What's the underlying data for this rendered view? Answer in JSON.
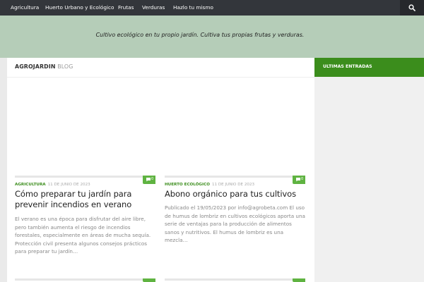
{
  "nav": {
    "items": [
      "Agricultura",
      "Huerto Urbano y Ecológico",
      "Frutas",
      "Verduras",
      "Hazlo tu mismo"
    ],
    "search_icon": "search-icon"
  },
  "header": {
    "tagline": "Cultivo ecológico en tu propio jardín. Cultiva tus propias frutas y verduras."
  },
  "main": {
    "title_strong": "Agrojardin",
    "title_light": "Blog",
    "posts": [
      {
        "category": "Agricultura",
        "date": "11 de junio de 2023",
        "comments": "0",
        "title": "Cómo preparar tu jardín para prevenir incendios en verano",
        "excerpt": "El verano es una época para disfrutar del aire libre, pero también aumenta el riesgo de incendios forestales, especialmente en áreas de mucha sequía. Protección civil presenta algunos consejos prácticos para preparar tu jardín…"
      },
      {
        "category": "Huerto ecológico",
        "date": "11 de junio de 2023",
        "comments": "0",
        "title": "Abono orgánico para tus cultivos",
        "excerpt": "Publicado el 19/05/2023 por info@agrobeta.com El uso de humus de lombriz en cultivos ecológicos aporta una serie de ventajas para la producción de alimentos sanos y nutritivos. El humus de lombriz es una mezcla…"
      }
    ]
  },
  "sidebar": {
    "title": "Ultimas entradas"
  },
  "colors": {
    "nav_bg": "#33363b",
    "header_bg": "#b5cdb8",
    "accent_green": "#3b8d1c",
    "badge_green": "#5fb341"
  }
}
